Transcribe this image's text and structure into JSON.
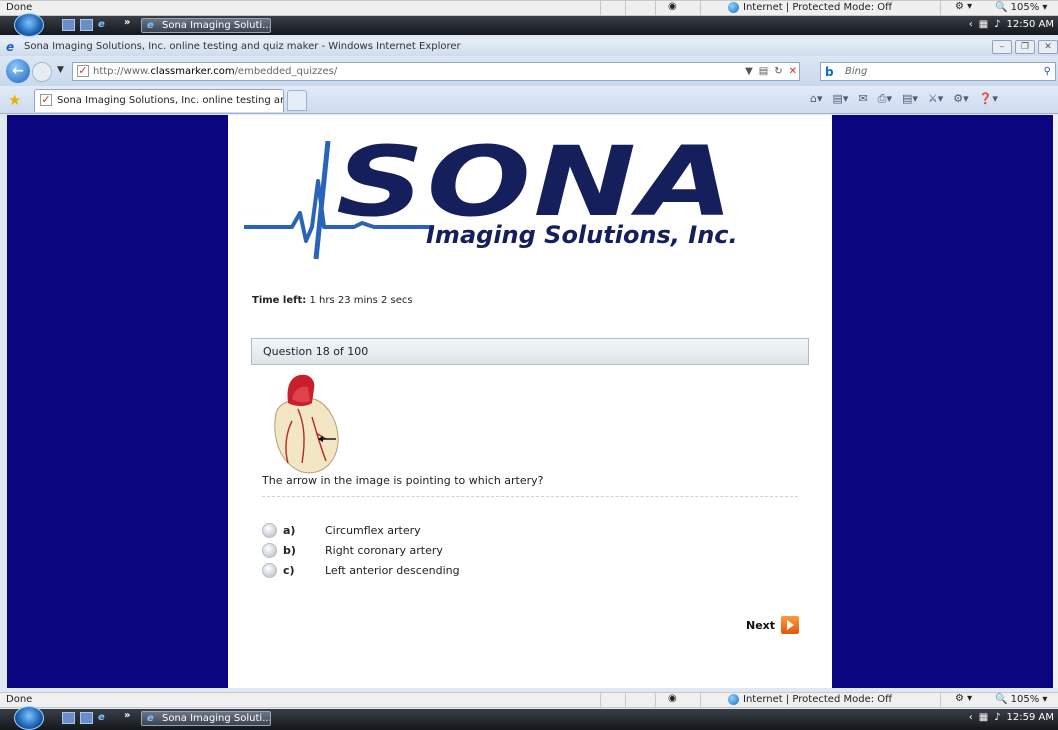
{
  "status_top": {
    "text": "Done",
    "zone": "Internet | Protected Mode: Off",
    "zoom": "105%"
  },
  "taskbar_top": {
    "task": "Sona Imaging Soluti...",
    "clock": "12:50 AM"
  },
  "window": {
    "title": "Sona Imaging Solutions, Inc. online testing and quiz maker - Windows Internet Explorer"
  },
  "address": {
    "prefix": "http://www.",
    "domain": "classmarker.com",
    "path": "/embedded_quizzes/"
  },
  "search": {
    "placeholder": "Bing"
  },
  "tab": {
    "title": "Sona Imaging Solutions, Inc. online testing and q..."
  },
  "logo": {
    "wordmark": "SONA",
    "tagline": "Imaging Solutions, Inc."
  },
  "quiz": {
    "time_left_label": "Time left:",
    "time_left_value": "1 hrs 23 mins 2 secs",
    "question_header": "Question 18 of 100",
    "question_text": "The arrow in the image is pointing to which artery?",
    "options": [
      {
        "letter": "a)",
        "text": "Circumflex artery"
      },
      {
        "letter": "b)",
        "text": "Right coronary artery"
      },
      {
        "letter": "c)",
        "text": "Left anterior descending"
      }
    ],
    "next_label": "Next"
  },
  "status_bottom": {
    "text": "Done",
    "zone": "Internet | Protected Mode: Off",
    "zoom": "105%"
  },
  "taskbar_bottom": {
    "task": "Sona Imaging Soluti...",
    "clock": "12:59 AM"
  },
  "colors": {
    "page_bg": "#0b0580",
    "logo": "#141f5c",
    "accent_line": "#2a64b8",
    "next_button": "#e2570c"
  }
}
